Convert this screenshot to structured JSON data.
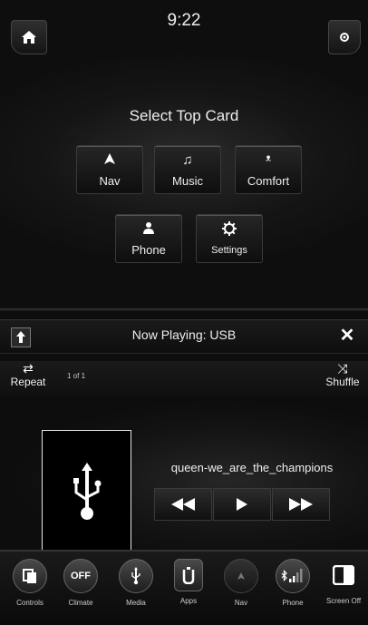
{
  "status": {
    "time": "9:22"
  },
  "top_card": {
    "title": "Select Top Card",
    "cards": [
      {
        "label": "Nav",
        "icon": "navigation-arrow-icon"
      },
      {
        "label": "Music",
        "icon": "music-note-icon"
      },
      {
        "label": "Comfort",
        "icon": "comfort-fan-icon"
      },
      {
        "label": "Phone",
        "icon": "person-icon"
      },
      {
        "label": "Settings",
        "icon": "gear-icon"
      }
    ]
  },
  "now_playing": {
    "title": "Now Playing: USB",
    "repeat_label": "Repeat",
    "shuffle_label": "Shuffle",
    "track_count": "1 of 1",
    "song": "queen-we_are_the_champions"
  },
  "dock": {
    "items": [
      {
        "label": "Controls"
      },
      {
        "label": "Climate",
        "badge": "OFF"
      },
      {
        "label": "Media"
      },
      {
        "label": "Apps"
      },
      {
        "label": "Nav"
      },
      {
        "label": "Phone"
      },
      {
        "label": "Screen Off"
      }
    ]
  }
}
